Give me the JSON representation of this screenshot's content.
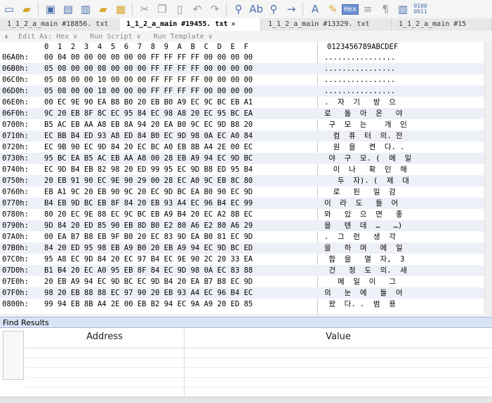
{
  "toolbar": {
    "buttons": [
      "new-file",
      "open-file",
      "save",
      "save-all",
      "copy-window",
      "new-folder",
      "folder-tree",
      "cut",
      "copy",
      "paste",
      "undo",
      "redo",
      "find",
      "replace",
      "find-next",
      "goto",
      "font",
      "highlight",
      "hex-mode",
      "spaces",
      "pilcrow",
      "columns",
      "binary"
    ],
    "hex_label": "Hex"
  },
  "tabs": [
    {
      "label": "1_1_2_a_main #18856. txt",
      "active": false
    },
    {
      "label": "1_1_2_a_main #19455. txt",
      "active": true
    },
    {
      "label": "1_1_2_a_main #13329. txt",
      "active": false
    },
    {
      "label": "1_1_2_a_main #15",
      "active": false
    }
  ],
  "tab_close": "✕",
  "editbar": {
    "edit_as": "Edit As: Hex ∨",
    "run_script": "Run Script ∨",
    "run_template": "Run Template ∨"
  },
  "hex": {
    "header_bytes": "0  1  2  3  4  5  6  7  8  9  A  B  C  D  E  F",
    "header_text": "0123456789ABCDEF",
    "rows": [
      {
        "addr": "06A0h:",
        "bytes": "00 04 00 00 00 00 00 00 FF FF FF FF 00 00 00 00",
        "text": "................"
      },
      {
        "addr": "06B0h:",
        "bytes": "05 08 00 00 08 00 00 00 FF FF FF FF 00 00 00 00",
        "text": "................"
      },
      {
        "addr": "06C0h:",
        "bytes": "05 08 00 00 10 00 00 00 FF FF FF FF 00 00 00 00",
        "text": "................"
      },
      {
        "addr": "06D0h:",
        "bytes": "05 08 00 00 18 00 00 00 FF FF FF FF 00 00 00 00",
        "text": "................"
      },
      {
        "addr": "06E0h:",
        "bytes": "00 EC 9E 90 EA B8 B0 20 EB B0 A9 EC 9C BC EB A1",
        "text": ".  자  기   방  으"
      },
      {
        "addr": "06F0h:",
        "bytes": "9C 20 EB 8F 8C EC 95 84 EC 98 A8 20 EC 95 BC EA",
        "text": "로   돌  아  온   야"
      },
      {
        "addr": "0700h:",
        "bytes": "B5 AC EB AA A8 EB 8A 94 20 EA B0 9C EC 9D B8 20",
        "text": " 구  모  는    개  인"
      },
      {
        "addr": "0710h:",
        "bytes": "EC BB B4 ED 93 A8 ED 84 B0 EC 9D 98 0A EC A0 84",
        "text": "  컴  퓨  터  의. 전"
      },
      {
        "addr": "0720h:",
        "bytes": "EC 9B 90 EC 9D 84 20 EC BC A0 EB 8B A4 2E 00 EC",
        "text": "  원  을   켠  다. ."
      },
      {
        "addr": "0730h:",
        "bytes": "95 BC EA B5 AC EB AA A8 00 28 EB A9 94 EC 9D BC",
        "text": " 야  구  모. (  메  일"
      },
      {
        "addr": "0740h:",
        "bytes": "EC 9D B4 EB 82 98 20 ED 99 95 EC 9D B8 ED 95 B4",
        "text": "  이  나   확  인  해"
      },
      {
        "addr": "0750h:",
        "bytes": "20 EB 91 90 EC 9E 90 29 00 28 EC A0 9C EB 8C 80",
        "text": "   두  자). (  제  대"
      },
      {
        "addr": "0760h:",
        "bytes": "EB A1 9C 20 EB 90 9C 20 EC 9D BC EA B0 90 EC 9D",
        "text": "  로   된   일  감"
      },
      {
        "addr": "0770h:",
        "bytes": "B4 EB 9D BC EB 8F 84 20 EB 93 A4 EC 96 B4 EC 99",
        "text": "이  라  도   들  어"
      },
      {
        "addr": "0780h:",
        "bytes": "80 20 EC 9E 88 EC 9C BC EB A9 B4 20 EC A2 8B EC",
        "text": "와   있  으  면   좋"
      },
      {
        "addr": "0790h:",
        "bytes": "9D 84 20 ED 85 90 EB 8D B0 E2 80 A6 E2 80 A6 29",
        "text": "을   텐  데  …   …)"
      },
      {
        "addr": "07A0h:",
        "bytes": "00 EA B7 B8 EB 9F B0 20 EC 83 9D EA B0 81 EC 9D",
        "text": ".  그  런   생  각"
      },
      {
        "addr": "07B0h:",
        "bytes": "84 20 ED 95 98 EB A9 B0 20 EB A9 94 EC 9D BC ED",
        "text": "을   하  며   메  일"
      },
      {
        "addr": "07C0h:",
        "bytes": "95 A8 EC 9D 84 20 EC 97 B4 EC 9E 90 2C 20 33 EA",
        "text": " 함  을   열  자,  3"
      },
      {
        "addr": "07D0h:",
        "bytes": "B1 B4 20 EC A0 95 EB 8F 84 EC 9D 98 0A EC 83 88",
        "text": " 건   정  도  의.  새"
      },
      {
        "addr": "07E0h:",
        "bytes": "20 EB A9 94 EC 9D BC EC 9D B4 20 EA B7 B8 EC 9D",
        "text": "   메  일  이   그"
      },
      {
        "addr": "07F0h:",
        "bytes": "98 20 EB 88 88 EC 97 90 20 EB 93 A4 EC 96 B4 EC",
        "text": "의   눈  에   들  어"
      },
      {
        "addr": "0800h:",
        "bytes": "99 94 EB 8B A4 2E 00 EB B2 94 EC 9A A9 20 ED 85",
        "text": " 왔  다. .  범  용"
      }
    ]
  },
  "find": {
    "header": "Find Results",
    "col_address": "Address",
    "col_value": "Value"
  }
}
